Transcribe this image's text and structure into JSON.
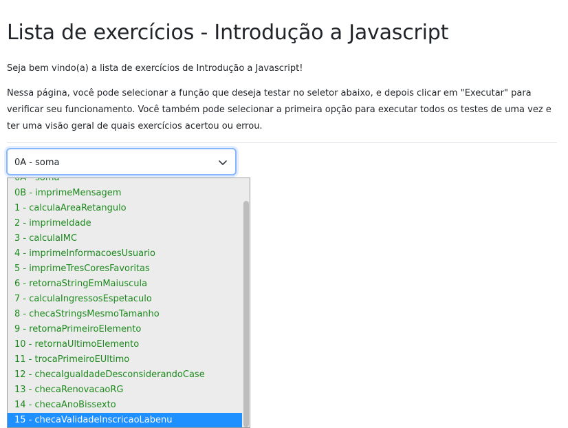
{
  "page": {
    "title": "Lista de exercícios - Introdução a Javascript",
    "welcome": "Seja bem vindo(a) a lista de exercícios de Introdução a Javascript!",
    "instructions": "Nessa página, você pode selecionar a função que deseja testar no seletor abaixo, e depois clicar em \"Executar\" para verificar seu funcionamento. Você também pode selecionar a primeira opção para executar todos os testes de uma vez e ter uma visão geral de quais exercícios acertou ou errou."
  },
  "selector": {
    "selected_label": "0A - soma",
    "chevron_icon": "chevron-down-icon",
    "options": [
      "0A - soma",
      "0B - imprimeMensagem",
      "1 - calculaAreaRetangulo",
      "2 - imprimeIdade",
      "3 - calculaIMC",
      "4 - imprimeInformacoesUsuario",
      "5 - imprimeTresCoresFavoritas",
      "6 - retornaStringEmMaiuscula",
      "7 - calculaIngressosEspetaculo",
      "8 - checaStringsMesmoTamanho",
      "9 - retornaPrimeiroElemento",
      "10 - retornaUltimoElemento",
      "11 - trocaPrimeiroEUltimo",
      "12 - checaIgualdadeDesconsiderandoCase",
      "13 - checaRenovacaoRG",
      "14 - checaAnoBissexto",
      "15 - checaValidadeInscricaoLabenu"
    ],
    "highlighted_option": "15 - checaValidadeInscricaoLabenu"
  },
  "colors": {
    "option_text": "#1d8a1d",
    "highlight_bg": "#1e90ff",
    "focus_border": "#86b7fe"
  }
}
